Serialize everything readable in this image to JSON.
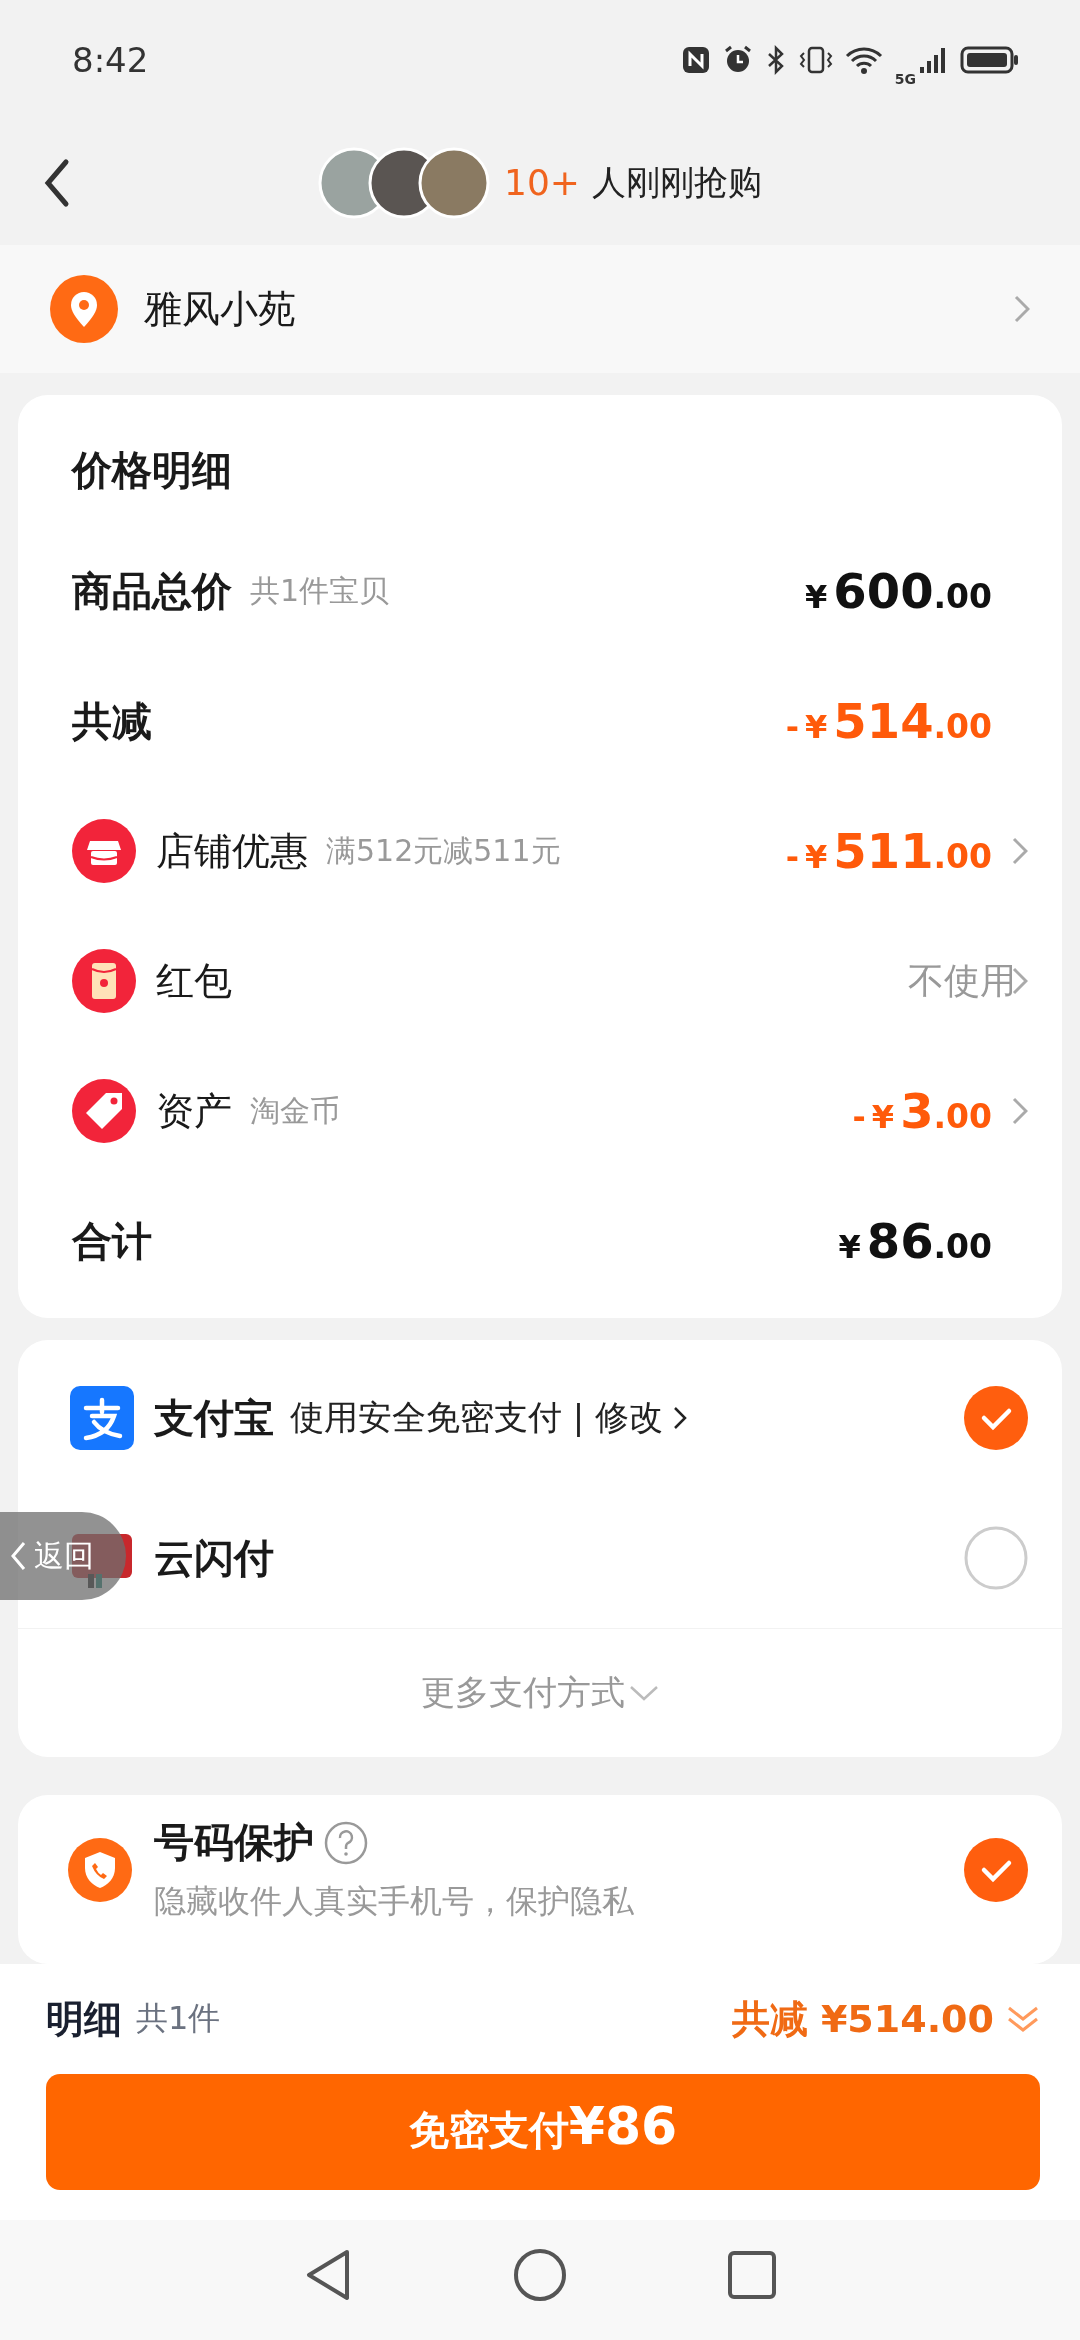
{
  "status_bar": {
    "time": "8:42",
    "network": "5G"
  },
  "header": {
    "buyers_count": "10+",
    "buyers_text": "人刚刚抢购"
  },
  "address": {
    "name": "雅风小苑"
  },
  "price_details": {
    "title": "价格明细",
    "rows": [
      {
        "kind": "summary",
        "label": "商品总价",
        "note": "共1件宝贝",
        "amount": {
          "currency": "¥",
          "integer": "600",
          "decimal": ".00"
        },
        "highlight": false,
        "arrow": false
      },
      {
        "kind": "summary",
        "label": "共减",
        "amount": {
          "sign": "-",
          "currency": "¥",
          "integer": "514",
          "decimal": ".00"
        },
        "highlight": true,
        "arrow": false
      },
      {
        "kind": "shop",
        "label": "店铺优惠",
        "note": "满512元减511元",
        "amount": {
          "sign": "-",
          "currency": "¥",
          "integer": "511",
          "decimal": ".00"
        },
        "highlight": true,
        "arrow": true
      },
      {
        "kind": "redpacket",
        "label": "红包",
        "value": "不使用",
        "highlight": false,
        "arrow": true
      },
      {
        "kind": "assets",
        "label": "资产",
        "note": "淘金币",
        "amount": {
          "sign": "-",
          "currency": "¥",
          "integer": "3",
          "decimal": ".00"
        },
        "highlight": true,
        "arrow": true
      },
      {
        "kind": "summary",
        "label": "合计",
        "amount": {
          "currency": "¥",
          "integer": "86",
          "decimal": ".00"
        },
        "highlight": false,
        "arrow": false
      }
    ]
  },
  "payment": {
    "methods": [
      {
        "name": "支付宝",
        "desc": "使用安全免密支付 | 修改",
        "selected": true
      },
      {
        "name": "云闪付",
        "selected": false
      }
    ],
    "more": "更多支付方式"
  },
  "phone_protection": {
    "title": "号码保护",
    "desc": "隐藏收件人真实手机号，保护隐私",
    "checked": true
  },
  "gesture_back": {
    "label": "返回"
  },
  "bottom_bar": {
    "label": "明细",
    "count": "共1件",
    "discount": "共减 ¥514.00",
    "pay_label": "免密支付",
    "pay_amount": "¥86"
  }
}
